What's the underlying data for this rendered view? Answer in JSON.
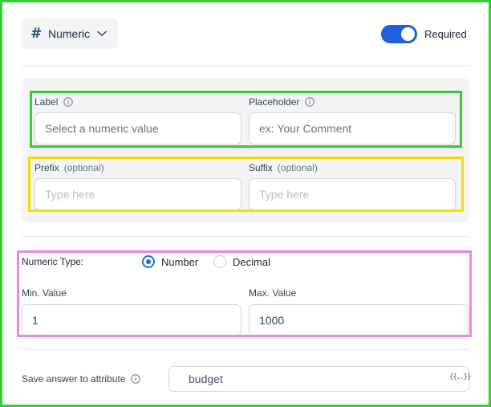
{
  "field_type": {
    "label": "Numeric",
    "icon": "hash-icon"
  },
  "required": {
    "label": "Required",
    "enabled": true
  },
  "label_field": {
    "label": "Label",
    "placeholder": "Select a numeric value"
  },
  "placeholder_field": {
    "label": "Placeholder",
    "placeholder": "ex: Your Comment"
  },
  "prefix_field": {
    "label": "Prefix",
    "optional": "(optional)",
    "placeholder": "Type here"
  },
  "suffix_field": {
    "label": "Suffix",
    "optional": "(optional)",
    "placeholder": "Type here"
  },
  "numeric_type": {
    "label": "Numeric Type:",
    "options": [
      {
        "label": "Number",
        "checked": true
      },
      {
        "label": "Decimal",
        "checked": false
      }
    ]
  },
  "min_value": {
    "label": "Min. Value",
    "value": "1"
  },
  "max_value": {
    "label": "Max. Value",
    "value": "1000"
  },
  "attribute": {
    "label": "Save answer to attribute",
    "value": "budget",
    "icon_text": "{{..}}"
  },
  "colors": {
    "accent": "#1d5fe0",
    "outline_green": "#33cc33",
    "outline_yellow": "#f2df00",
    "outline_pink": "#ee82ee"
  }
}
